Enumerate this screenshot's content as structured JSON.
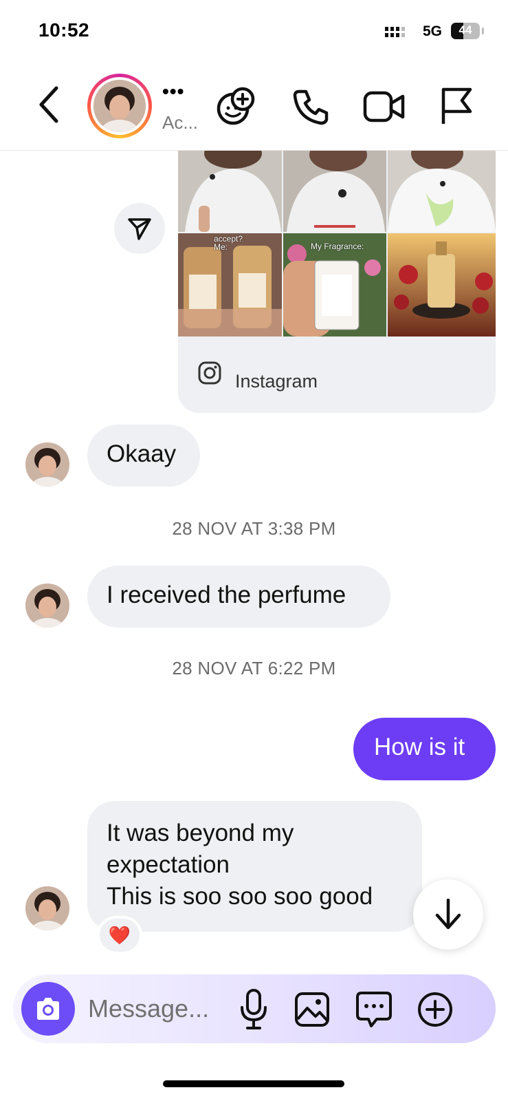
{
  "status_bar": {
    "time": "10:52",
    "network": "5G",
    "battery": "44",
    "battery_level": 0.44
  },
  "header": {
    "contact_dots": "•••",
    "contact_name": "Ac..."
  },
  "shared_post": {
    "thumb_labels": [
      "accept?\nMe:",
      "My Fragrance:"
    ],
    "source_label": "Instagram"
  },
  "messages": [
    {
      "direction": "in",
      "text": "Okaay"
    },
    {
      "timestamp": "28 NOV AT 3:38 PM"
    },
    {
      "direction": "in",
      "text": "I received the perfume"
    },
    {
      "timestamp": "28 NOV AT 6:22 PM"
    },
    {
      "direction": "out",
      "text": "How is it"
    },
    {
      "direction": "in",
      "lines": [
        "It was beyond my",
        "expectation",
        "This is soo soo soo good"
      ],
      "reaction": "❤️"
    }
  ],
  "composer": {
    "placeholder": "Message..."
  },
  "colors": {
    "accent": "#6c3df5",
    "bubble_in": "#eef0f3",
    "camera": "#6c4df7"
  }
}
